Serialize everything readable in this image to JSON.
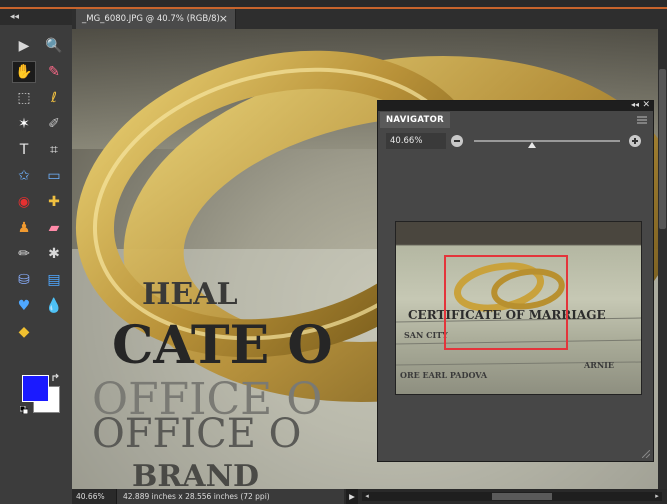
{
  "document": {
    "tab_title": "_MG_6080.JPG @ 40.7% (RGB/8)",
    "close_label": "×"
  },
  "toolbar": {
    "grip_label": "◂◂",
    "tools": [
      {
        "name": "move-tool-icon",
        "glyph": "▶"
      },
      {
        "name": "zoom-tool-icon",
        "glyph": "🔍"
      },
      {
        "name": "hand-tool-icon",
        "glyph": "✋"
      },
      {
        "name": "eyedropper-tool-icon",
        "glyph": "✎"
      },
      {
        "name": "marquee-tool-icon",
        "glyph": "⬚"
      },
      {
        "name": "lasso-tool-icon",
        "glyph": "ℓ"
      },
      {
        "name": "magic-wand-tool-icon",
        "glyph": "✶"
      },
      {
        "name": "quick-selection-tool-icon",
        "glyph": "✐"
      },
      {
        "name": "type-tool-icon",
        "glyph": "T"
      },
      {
        "name": "crop-tool-icon",
        "glyph": "⌗"
      },
      {
        "name": "cookie-cutter-tool-icon",
        "glyph": "✩"
      },
      {
        "name": "straighten-tool-icon",
        "glyph": "▭"
      },
      {
        "name": "red-eye-tool-icon",
        "glyph": "◉"
      },
      {
        "name": "healing-brush-tool-icon",
        "glyph": "✚"
      },
      {
        "name": "clone-stamp-tool-icon",
        "glyph": "♟"
      },
      {
        "name": "eraser-tool-icon",
        "glyph": "▰"
      },
      {
        "name": "brush-tool-icon",
        "glyph": "✏"
      },
      {
        "name": "smart-brush-tool-icon",
        "glyph": "✱"
      },
      {
        "name": "paint-bucket-tool-icon",
        "glyph": "⛁"
      },
      {
        "name": "gradient-tool-icon",
        "glyph": "▤"
      },
      {
        "name": "custom-shape-tool-icon",
        "glyph": "♥"
      },
      {
        "name": "blur-tool-icon",
        "glyph": "💧"
      },
      {
        "name": "sponge-tool-icon",
        "glyph": "◆"
      }
    ]
  },
  "colors": {
    "foreground": "#1a1aff",
    "background": "#ffffff",
    "accent_bar": "#c8642c",
    "view_box": "#e4343b"
  },
  "navigator": {
    "title": "NAVIGATOR",
    "zoom_value": "40.66%",
    "zoom_slider_fraction": 0.4,
    "collapse_label": "◂◂",
    "close_label": "✕"
  },
  "status": {
    "zoom": "40.66%",
    "doc_size": "42.889 inches x 28.556 inches (72 ppi)",
    "arrow_label": "▶",
    "scroll_left": "◂",
    "scroll_right": "▸"
  },
  "canvas_text": {
    "line1": "HEAL",
    "line2": "CATE O",
    "line3": "OFFICE O",
    "line4": "OFFICE O",
    "line5": "BRAND",
    "thumb_line1": "CERTIFICATE OF MARRIAGE",
    "thumb_line2": "SAN CITY",
    "thumb_line3": "ORE EARL PADOVA",
    "thumb_line4": "ARNIE"
  }
}
